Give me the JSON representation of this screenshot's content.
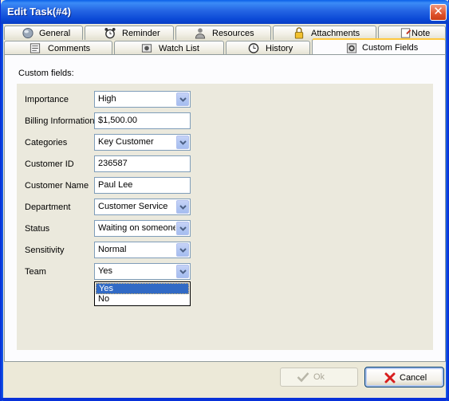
{
  "window": {
    "title": "Edit Task(#4)",
    "close_glyph": "✕"
  },
  "tabs_row1": [
    {
      "label": "General",
      "icon": "globe-icon"
    },
    {
      "label": "Reminder",
      "icon": "alarm-clock-icon"
    },
    {
      "label": "Resources",
      "icon": "person-icon"
    },
    {
      "label": "Attachments",
      "icon": "paperclip-icon"
    },
    {
      "label": "Note",
      "icon": "note-icon"
    }
  ],
  "tabs_row2": [
    {
      "label": "Comments",
      "icon": "comments-icon"
    },
    {
      "label": "Watch List",
      "icon": "watch-list-icon"
    },
    {
      "label": "History",
      "icon": "clock-icon"
    },
    {
      "label": "Custom Fields",
      "icon": "gear-icon",
      "active": true
    }
  ],
  "panel": {
    "caption": "Custom fields:",
    "fields": [
      {
        "label": "Importance",
        "type": "select",
        "value": "High"
      },
      {
        "label": "Billing Information",
        "type": "text",
        "value": "$1,500.00"
      },
      {
        "label": "Categories",
        "type": "select",
        "value": "Key Customer"
      },
      {
        "label": "Customer ID",
        "type": "text",
        "value": "236587"
      },
      {
        "label": "Customer Name",
        "type": "text",
        "value": "Paul Lee"
      },
      {
        "label": "Department",
        "type": "select",
        "value": "Customer Service"
      },
      {
        "label": "Status",
        "type": "select",
        "value": "Waiting on someone"
      },
      {
        "label": "Sensitivity",
        "type": "select",
        "value": "Normal"
      },
      {
        "label": "Team",
        "type": "select",
        "value": "Yes"
      }
    ],
    "team_options": [
      "Yes",
      "No"
    ],
    "team_highlighted": "Yes"
  },
  "buttons": {
    "ok": {
      "label": "Ok",
      "enabled": false
    },
    "cancel": {
      "label": "Cancel",
      "enabled": true
    }
  },
  "colors": {
    "titlebar": "#0a4ed8",
    "active_tab_highlight": "#ffc83c",
    "selection": "#316ac5",
    "cancel_icon": "#d81e1e",
    "ok_icon_disabled": "#b8b6a8"
  }
}
